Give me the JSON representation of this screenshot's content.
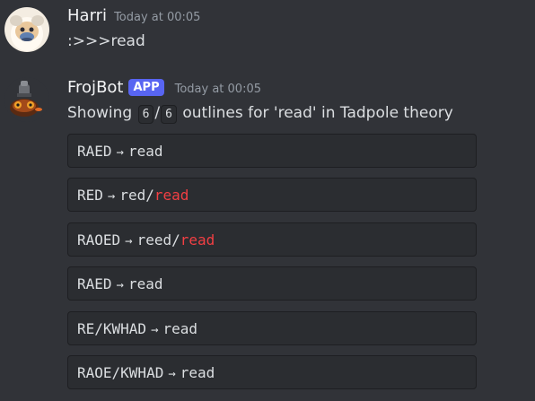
{
  "messages": {
    "user": {
      "username": "Harri",
      "timestamp": "Today at 00:05",
      "text": ":>>>read",
      "avatar_icon": "monkey-avatar-icon"
    },
    "bot": {
      "username": "FrojBot",
      "tag": "APP",
      "timestamp": "Today at 00:05",
      "intro_prefix": "Showing",
      "count_shown": "6",
      "separator": "/",
      "count_total": "6",
      "intro_suffix": "outlines for 'read' in Tadpole theory",
      "avatar_icon": "frog-bot-avatar-icon",
      "arrow": "→",
      "outlines": [
        {
          "stroke": "RAED",
          "word": "read",
          "conflict": ""
        },
        {
          "stroke": "RED",
          "word": "red/",
          "conflict": "read"
        },
        {
          "stroke": "RAOED",
          "word": "reed/",
          "conflict": "read"
        },
        {
          "stroke": "RAED",
          "word": "read",
          "conflict": ""
        },
        {
          "stroke": "RE/KWHAD",
          "word": "read",
          "conflict": ""
        },
        {
          "stroke": "RAOE/KWHAD",
          "word": "read",
          "conflict": ""
        }
      ]
    }
  },
  "colors": {
    "background": "#313338",
    "code_background": "#2b2d31",
    "app_tag": "#5865f2",
    "conflict": "#f23f43"
  }
}
